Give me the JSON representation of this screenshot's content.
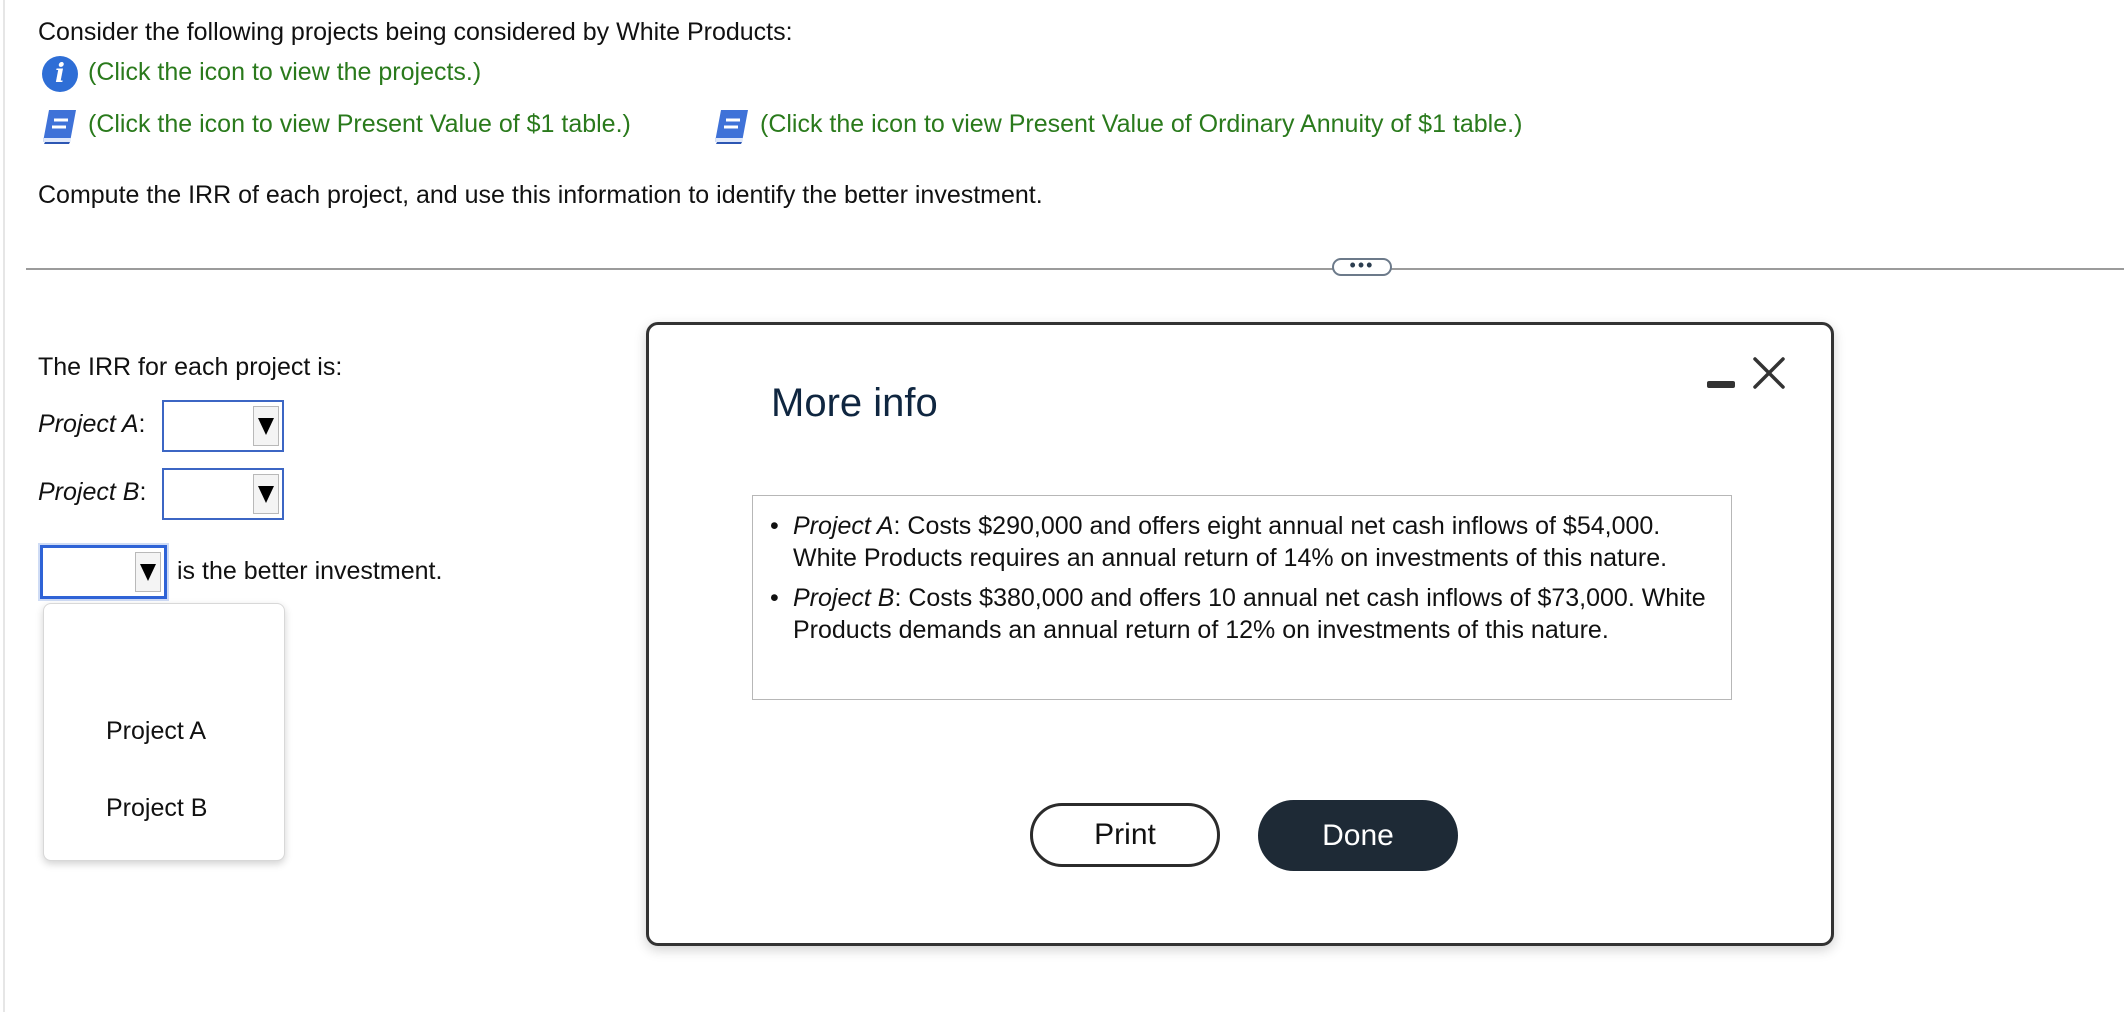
{
  "question": {
    "intro": "Consider the following projects being considered by White Products:",
    "link_projects": "(Click the icon to view the projects.)",
    "link_pv_table": "(Click the icon to view Present Value of $1 table.)",
    "link_pv_annuity_table": "(Click the icon to view Present Value of Ordinary Annuity of $1 table.)",
    "instruction": "Compute the IRR of each project, and use this information to identify the better investment."
  },
  "divider": {
    "handle_label": "•••"
  },
  "answer": {
    "irr_heading": "The IRR for each project is:",
    "project_a_label": "Project A",
    "project_b_label": "Project B",
    "colon": ":",
    "project_a_value": "",
    "project_b_value": "",
    "better_investment_value": "",
    "better_investment_suffix": "is the better investment."
  },
  "dropdown": {
    "options": [
      "Project A",
      "Project B"
    ]
  },
  "modal": {
    "title": "More info",
    "items": [
      {
        "name": "Project A",
        "text": ": Costs $290,000 and offers eight annual net cash inflows of $54,000. White Products requires an annual return of 14% on investments of this nature."
      },
      {
        "name": "Project B",
        "text": ": Costs $380,000 and offers 10 annual net cash inflows of $73,000. White Products demands an annual return of 12% on investments of this nature."
      }
    ],
    "print_label": "Print",
    "done_label": "Done"
  },
  "colors": {
    "link_green": "#2a7a1c",
    "select_border": "#3c66c4",
    "info_icon_blue": "#2e6ed6",
    "done_button_bg": "#1e2a36",
    "modal_title": "#0f2640"
  },
  "icons": {
    "info": "info-icon",
    "book": "book-icon",
    "minimize": "minimize-icon",
    "close": "close-icon"
  }
}
